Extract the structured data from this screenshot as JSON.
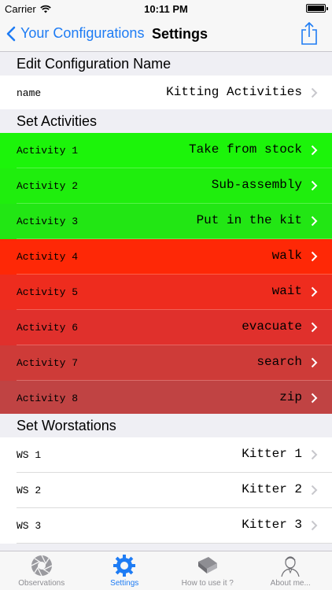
{
  "status_bar": {
    "carrier": "Carrier",
    "time": "10:11 PM"
  },
  "nav": {
    "back_label": "Your Configurations",
    "title": "Settings"
  },
  "sections": {
    "config_name": {
      "header": "Edit Configuration Name"
    },
    "activities": {
      "header": "Set Activities"
    },
    "workstations": {
      "header": "Set Worstations"
    }
  },
  "config_row": {
    "label": "name",
    "value": "Kitting Activities"
  },
  "activities": [
    {
      "label": "Activity 1",
      "value": "Take from stock",
      "color": "#1cf40a"
    },
    {
      "label": "Activity 2",
      "value": "Sub-assembly",
      "color": "#1fee0d"
    },
    {
      "label": "Activity 3",
      "value": "Put in the kit",
      "color": "#22e614"
    },
    {
      "label": "Activity 4",
      "value": "walk",
      "color": "#fe2806"
    },
    {
      "label": "Activity 5",
      "value": "wait",
      "color": "#ee2c1e"
    },
    {
      "label": "Activity 6",
      "value": "evacuate",
      "color": "#e0302c"
    },
    {
      "label": "Activity 7",
      "value": "search",
      "color": "#ce3b38"
    },
    {
      "label": "Activity 8",
      "value": "zip",
      "color": "#c04343"
    }
  ],
  "workstations": [
    {
      "label": "WS 1",
      "value": "Kitter 1"
    },
    {
      "label": "WS 2",
      "value": "Kitter 2"
    },
    {
      "label": "WS 3",
      "value": "Kitter 3"
    }
  ],
  "tabs": [
    {
      "label": "Observations",
      "icon": "aperture-icon",
      "active": false
    },
    {
      "label": "Settings",
      "icon": "gear-icon",
      "active": true
    },
    {
      "label": "How to use it ?",
      "icon": "book-icon",
      "active": false
    },
    {
      "label": "About me...",
      "icon": "person-sketch-icon",
      "active": false
    }
  ],
  "colors": {
    "accent": "#1e7cf4",
    "inactive": "#8e8e93"
  }
}
